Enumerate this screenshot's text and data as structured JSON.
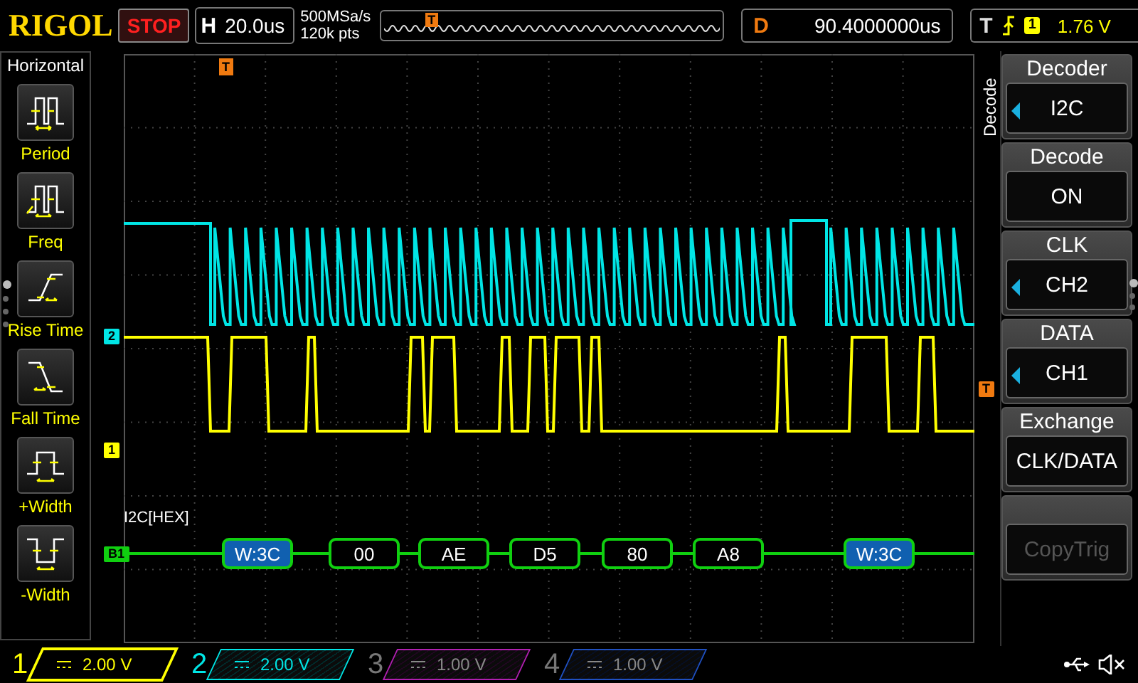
{
  "header": {
    "logo": "RIGOL",
    "run_state": "STOP",
    "horizontal": {
      "label": "H",
      "value": "20.0us"
    },
    "sample_rate": "500MSa/s",
    "memory_depth": "120k pts",
    "position_marker": "T",
    "delay": {
      "label": "D",
      "value": "90.4000000us"
    },
    "trigger": {
      "label": "T",
      "source": "1",
      "level": "1.76 V"
    }
  },
  "left_menu": {
    "title": "Horizontal",
    "items": [
      {
        "label": "Period",
        "kind": "period"
      },
      {
        "label": "Freq",
        "kind": "freq"
      },
      {
        "label": "Rise Time",
        "kind": "rise"
      },
      {
        "label": "Fall Time",
        "kind": "fall"
      },
      {
        "label": "+Width",
        "kind": "pwidth"
      },
      {
        "label": "-Width",
        "kind": "nwidth"
      }
    ],
    "page_dots": [
      {
        "selected": true
      },
      {
        "selected": false
      },
      {
        "selected": false
      },
      {
        "selected": false
      }
    ]
  },
  "waveform": {
    "top_marker": "T",
    "markers": [
      {
        "label": "2",
        "kind": "ch2"
      },
      {
        "label": "1",
        "kind": "ch1"
      },
      {
        "label": "B1",
        "kind": "bus"
      },
      {
        "label": "T",
        "kind": "trigger"
      }
    ],
    "decode_label": "I2C[HEX]",
    "packets": [
      {
        "text": "W:3C",
        "kind": "address"
      },
      {
        "text": "00",
        "kind": "data"
      },
      {
        "text": "AE",
        "kind": "data"
      },
      {
        "text": "D5",
        "kind": "data"
      },
      {
        "text": "80",
        "kind": "data"
      },
      {
        "text": "A8",
        "kind": "data"
      },
      {
        "text": "W:3C",
        "kind": "address"
      }
    ]
  },
  "right_menu": {
    "title": "Decode",
    "items": [
      {
        "label": "Decoder",
        "value": "I2C",
        "adjustable": true,
        "disabled": false
      },
      {
        "label": "Decode",
        "value": "ON",
        "adjustable": false,
        "disabled": false
      },
      {
        "label": "CLK",
        "value": "CH2",
        "adjustable": true,
        "disabled": false
      },
      {
        "label": "DATA",
        "value": "CH1",
        "adjustable": true,
        "disabled": false
      },
      {
        "label": "Exchange",
        "value": "CLK/DATA",
        "adjustable": false,
        "disabled": false
      },
      {
        "value": "CopyTrig",
        "adjustable": false,
        "disabled": true
      }
    ],
    "page_dots": [
      {
        "selected": true
      },
      {
        "selected": false
      },
      {
        "selected": false
      }
    ]
  },
  "channels": [
    {
      "number": "1",
      "scale": "2.00 V",
      "color": "#ffff00",
      "enabled": true,
      "selected": true
    },
    {
      "number": "2",
      "scale": "2.00 V",
      "color": "#00e5e5",
      "enabled": true,
      "selected": false
    },
    {
      "number": "3",
      "scale": "1.00 V",
      "color": "#b020b0",
      "enabled": false,
      "selected": false
    },
    {
      "number": "4",
      "scale": "1.00 V",
      "color": "#2050c0",
      "enabled": false,
      "selected": false
    }
  ]
}
